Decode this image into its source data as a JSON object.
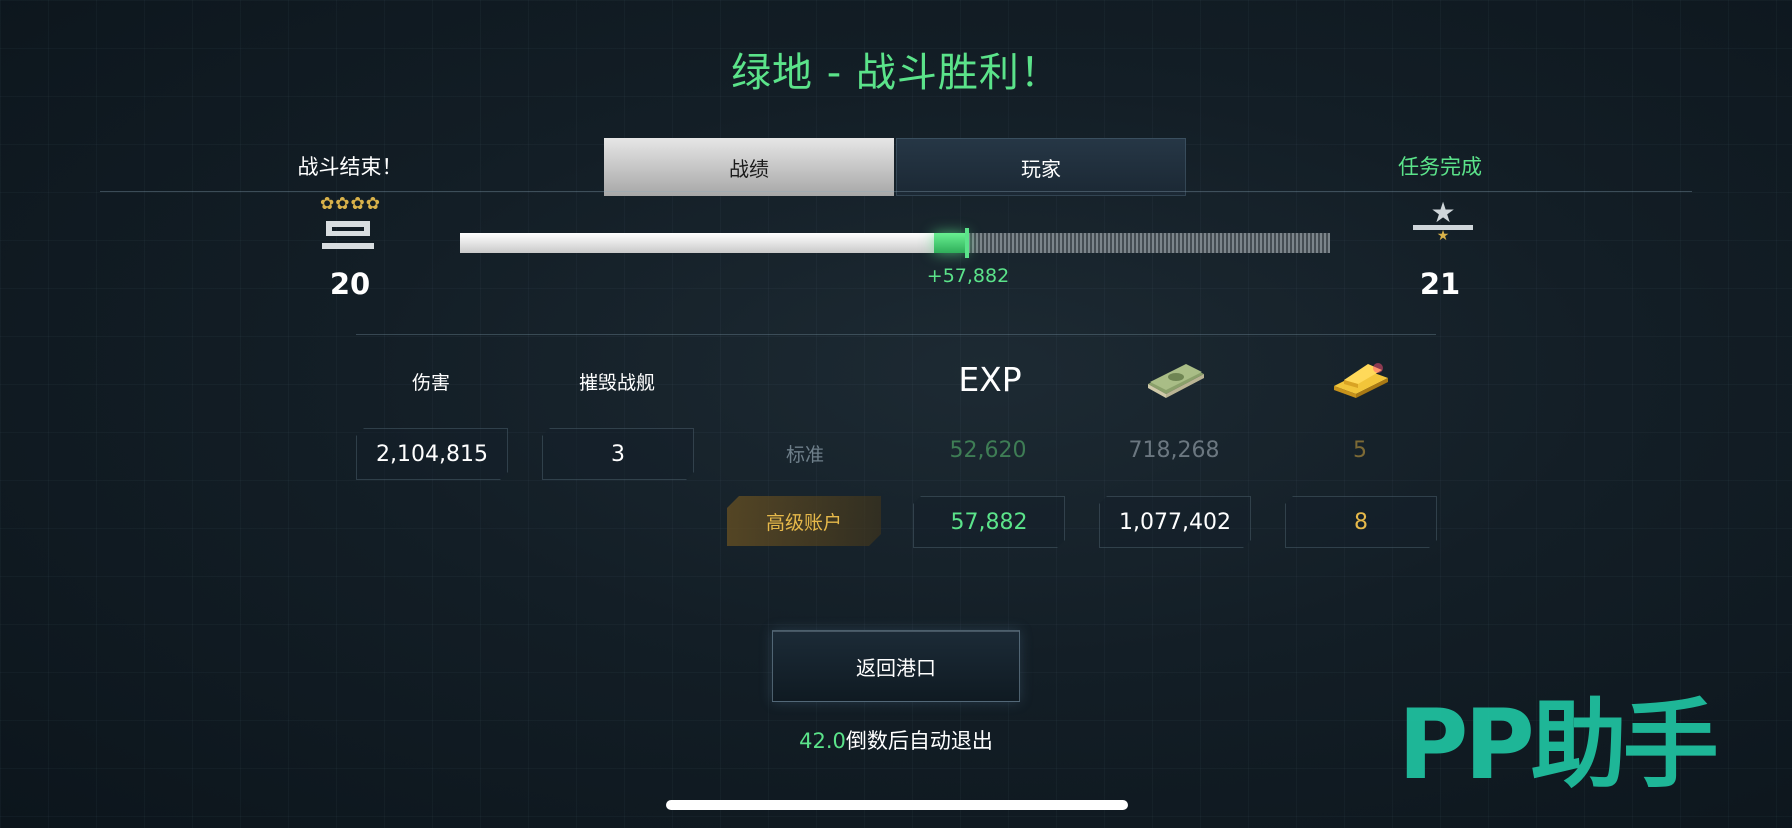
{
  "title": "绿地 - 战斗胜利！",
  "header": {
    "battle_over": "战斗结束！",
    "mission_complete": "任务完成"
  },
  "tabs": [
    {
      "label": "战绩",
      "active": true
    },
    {
      "label": "玩家",
      "active": false
    }
  ],
  "progress": {
    "current_level": "20",
    "next_level": "21",
    "rank_stars": 4,
    "xp_base_fraction": 0.545,
    "xp_gain_fraction": 0.038,
    "xp_gain_label": "+57,882"
  },
  "stats": {
    "damage_label": "伤害",
    "damage_value": "2,104,815",
    "kills_label": "摧毁战舰",
    "kills_value": "3"
  },
  "rewards": {
    "exp_header": "EXP",
    "money_icon": "cash-stack-icon",
    "gold_icon": "gold-bar-icon",
    "standard": {
      "label": "标准",
      "exp": "52,620",
      "money": "718,268",
      "gold": "5"
    },
    "premium": {
      "label": "高级账户",
      "exp": "57,882",
      "money": "1,077,402",
      "gold": "8"
    }
  },
  "return_button": "返回港口",
  "countdown": {
    "seconds": "42.0",
    "text": "倒数后自动退出"
  },
  "watermark": "PP助手",
  "colors": {
    "accent_green": "#5be38a",
    "premium_gold": "#e6b94a",
    "watermark_teal": "#1fbf9e"
  }
}
